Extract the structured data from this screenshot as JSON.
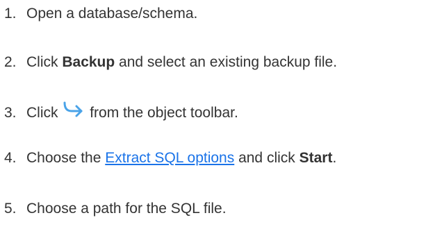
{
  "steps": [
    {
      "number": "1.",
      "text": "Open a database/schema."
    },
    {
      "number": "2.",
      "pre": "Click ",
      "bold": "Backup",
      "post": " and select an existing backup file."
    },
    {
      "number": "3.",
      "pre": "Click",
      "icon": "extract-arrow-icon",
      "post": "from the object toolbar."
    },
    {
      "number": "4.",
      "pre": "Choose the ",
      "link": "Extract SQL options",
      "mid": " and click ",
      "bold": "Start",
      "post": "."
    },
    {
      "number": "5.",
      "text": "Choose a path for the SQL file."
    }
  ],
  "colors": {
    "text": "#333333",
    "link": "#1a73e8",
    "icon": "#4aa3e8"
  }
}
